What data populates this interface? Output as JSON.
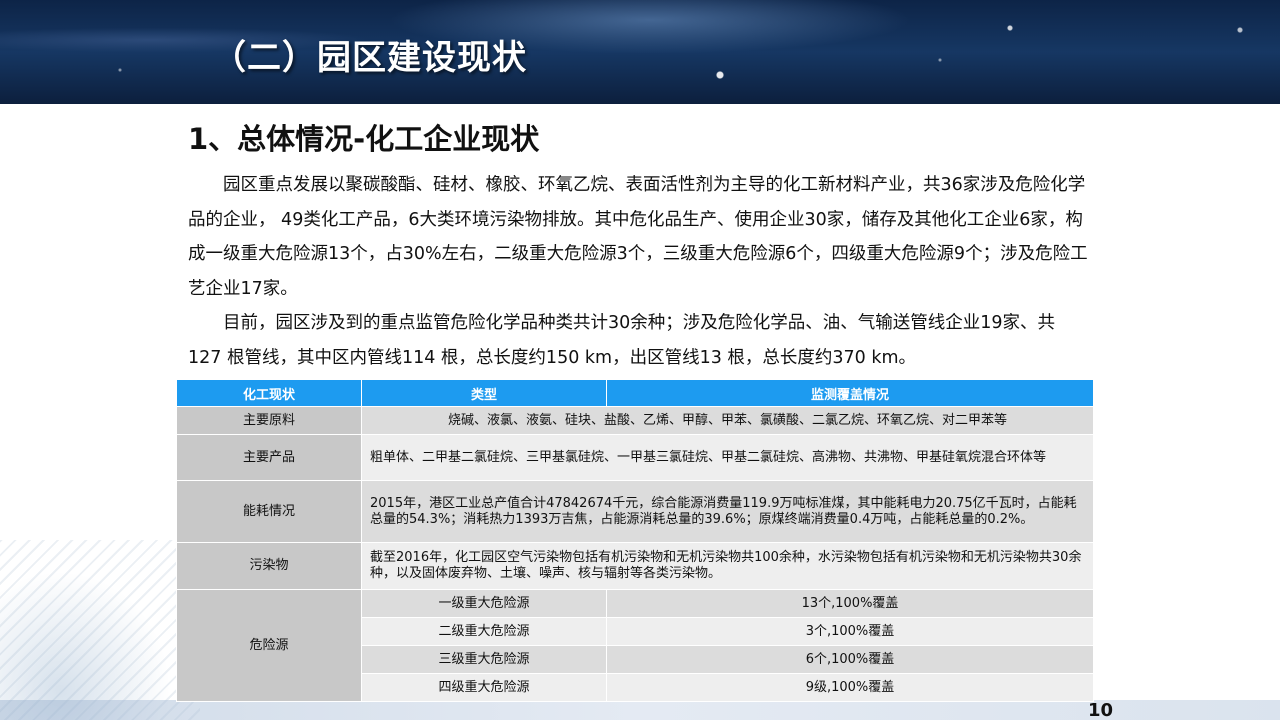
{
  "header": {
    "section_title": "（二）园区建设现状"
  },
  "main": {
    "heading": "1、总体情况-化工企业现状",
    "paragraph1": "园区重点发展以聚碳酸酯、硅材、橡胶、环氧乙烷、表面活性剂为主导的化工新材料产业，共36家涉及危险化学品的企业， 49类化工产品，6大类环境污染物排放。其中危化品生产、使用企业30家，储存及其他化工企业6家，构成一级重大危险源13个，占30%左右，二级重大危险源3个，三级重大危险源6个，四级重大危险源9个；涉及危险工艺企业17家。",
    "paragraph2": "目前，园区涉及到的重点监管危险化学品种类共计30余种；涉及危险化学品、油、气输送管线企业19家、共127 根管线，其中区内管线114 根，总长度约150 km，出区管线13 根，总长度约370 km。"
  },
  "table": {
    "headers": [
      "化工现状",
      "类型",
      "监测覆盖情况"
    ],
    "rows": [
      {
        "category": "主要原料",
        "content": "烧碱、液氯、液氨、硅块、盐酸、乙烯、甲醇、甲苯、氯磺酸、二氯乙烷、环氧乙烷、对二甲苯等"
      },
      {
        "category": "主要产品",
        "content": "粗单体、二甲基二氯硅烷、三甲基氯硅烷、一甲基三氯硅烷、甲基二氯硅烷、高沸物、共沸物、甲基硅氧烷混合环体等"
      },
      {
        "category": "能耗情况",
        "content": "2015年，港区工业总产值合计47842674千元，综合能源消费量119.9万吨标准煤，其中能耗电力20.75亿千瓦时，占能耗总量的54.3%；消耗热力1393万吉焦，占能源消耗总量的39.6%；原煤终端消费量0.4万吨，占能耗总量的0.2%。"
      },
      {
        "category": "污染物",
        "content": "截至2016年，化工园区空气污染物包括有机污染物和无机污染物共100余种，水污染物包括有机污染物和无机污染物共30余种，以及固体废弃物、土壤、噪声、核与辐射等各类污染物。"
      }
    ],
    "hazard": {
      "category": "危险源",
      "levels": [
        {
          "type": "一级重大危险源",
          "coverage": "13个,100%覆盖"
        },
        {
          "type": "二级重大危险源",
          "coverage": "3个,100%覆盖"
        },
        {
          "type": "三级重大危险源",
          "coverage": "6个,100%覆盖"
        },
        {
          "type": "四级重大危险源",
          "coverage": "9级,100%覆盖"
        }
      ]
    }
  },
  "footer": {
    "page_number": "10"
  }
}
